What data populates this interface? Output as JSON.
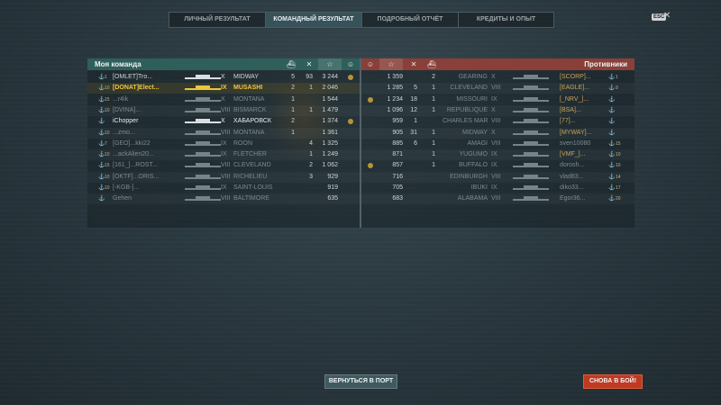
{
  "tabs": [
    "ЛИЧНЫЙ РЕЗУЛЬТАТ",
    "КОМАНДНЫЙ РЕЗУЛЬТАТ",
    "ПОДРОБНЫЙ ОТЧЁТ",
    "КРЕДИТЫ И ОПЫТ"
  ],
  "active_tab": 1,
  "esc_label": "ESC",
  "close_glyph": "✕",
  "my_team": {
    "title": "Моя команда",
    "header_icons": [
      "ships-icon",
      "kills-icon",
      "star-icon",
      "smile-icon"
    ],
    "rows": [
      {
        "rank": "1",
        "name": "[OMLET]Tro...",
        "tier": "X",
        "ship": "MIDWAY",
        "c1": "5",
        "c2": "93",
        "score": "3 244",
        "medal": true,
        "style": "normal"
      },
      {
        "rank": "10",
        "name": "[DONAT]Elect...",
        "tier": "IX",
        "ship": "MUSASHI",
        "c1": "2",
        "c2": "1",
        "score": "2 046",
        "medal": false,
        "style": "me"
      },
      {
        "rank": "15",
        "name": "...r4ik",
        "tier": "X",
        "ship": "MONTANA",
        "c1": "1",
        "c2": "",
        "score": "1 544",
        "medal": false,
        "style": "dim"
      },
      {
        "rank": "10",
        "name": "[DVINA]...",
        "tier": "VIII",
        "ship": "BISMARCK",
        "c1": "1",
        "c2": "1",
        "score": "1 479",
        "medal": false,
        "style": "dim"
      },
      {
        "rank": "",
        "name": "iChopper",
        "tier": "X",
        "ship": "ХАБАРОВСК",
        "c1": "2",
        "c2": "",
        "score": "1 374",
        "medal": true,
        "style": "bright"
      },
      {
        "rank": "10",
        "name": "...zmo...",
        "tier": "VIII",
        "ship": "MONTANA",
        "c1": "1",
        "c2": "",
        "score": "1 361",
        "medal": false,
        "style": "dim"
      },
      {
        "rank": "7",
        "name": "[GEO]...kki22",
        "tier": "IX",
        "ship": "ROON",
        "c1": "",
        "c2": "4",
        "score": "1 325",
        "medal": false,
        "style": "dim"
      },
      {
        "rank": "10",
        "name": "...ackAlien20...",
        "tier": "IX",
        "ship": "FLETCHER",
        "c1": "",
        "c2": "1",
        "score": "1 249",
        "medal": false,
        "style": "dim"
      },
      {
        "rank": "15",
        "name": "[161_]...ROST...",
        "tier": "VIII",
        "ship": "CLEVELAND",
        "c1": "",
        "c2": "2",
        "score": "1 062",
        "medal": false,
        "style": "dim"
      },
      {
        "rank": "10",
        "name": "[OKTF]...ORIS...",
        "tier": "VIII",
        "ship": "RICHELIEU",
        "c1": "",
        "c2": "3",
        "score": "929",
        "medal": false,
        "style": "dim"
      },
      {
        "rank": "10",
        "name": "[-KGB-]...",
        "tier": "IX",
        "ship": "SAINT-LOUIS",
        "c1": "",
        "c2": "",
        "score": "919",
        "medal": false,
        "style": "dim"
      },
      {
        "rank": "",
        "name": "Gehen",
        "tier": "VIII",
        "ship": "BALTIMORE",
        "c1": "",
        "c2": "",
        "score": "635",
        "medal": false,
        "style": "dim"
      }
    ]
  },
  "enemy_team": {
    "title": "Противники",
    "rows": [
      {
        "score": "1 359",
        "c1": "",
        "c2": "2",
        "ship": "GEARING",
        "tier": "X",
        "name": "[SCORP]...",
        "rank": "1",
        "medal": false
      },
      {
        "score": "1 285",
        "c1": "5",
        "c2": "1",
        "ship": "CLEVELAND",
        "tier": "VIII",
        "name": "[EAGLE]...",
        "rank": "9",
        "medal": false
      },
      {
        "score": "1 234",
        "c1": "18",
        "c2": "1",
        "ship": "MISSOURI",
        "tier": "IX",
        "name": "[_NRV_]...",
        "rank": "",
        "medal": true
      },
      {
        "score": "1 096",
        "c1": "12",
        "c2": "1",
        "ship": "REPUBLIQUE",
        "tier": "X",
        "name": "[BSA]...",
        "rank": "",
        "medal": false
      },
      {
        "score": "959",
        "c1": "1",
        "c2": "",
        "ship": "CHARLES MAR...",
        "tier": "VIII",
        "name": "[77]...",
        "rank": "",
        "medal": false
      },
      {
        "score": "905",
        "c1": "31",
        "c2": "1",
        "ship": "MIDWAY",
        "tier": "X",
        "name": "[MYWAY]...",
        "rank": "",
        "medal": false
      },
      {
        "score": "885",
        "c1": "6",
        "c2": "1",
        "ship": "AMAGI",
        "tier": "VIII",
        "name": "sven10080",
        "rank": "15",
        "medal": false
      },
      {
        "score": "871",
        "c1": "",
        "c2": "1",
        "ship": "YUGUMO",
        "tier": "IX",
        "name": "[VMF_]...",
        "rank": "10",
        "medal": false
      },
      {
        "score": "857",
        "c1": "",
        "c2": "1",
        "ship": "BUFFALO",
        "tier": "IX",
        "name": "dorosh...",
        "rank": "10",
        "medal": true
      },
      {
        "score": "716",
        "c1": "",
        "c2": "",
        "ship": "EDINBURGH",
        "tier": "VIII",
        "name": "vlad83...",
        "rank": "14",
        "medal": false
      },
      {
        "score": "705",
        "c1": "",
        "c2": "",
        "ship": "IBUKI",
        "tier": "IX",
        "name": "diko33...",
        "rank": "17",
        "medal": false
      },
      {
        "score": "683",
        "c1": "",
        "c2": "",
        "ship": "ALABAMA",
        "tier": "VIII",
        "name": "Egor36...",
        "rank": "20",
        "medal": false
      }
    ]
  },
  "buttons": {
    "port": "ВЕРНУТЬСЯ В ПОРТ",
    "battle": "СНОВА В БОЙ!"
  }
}
